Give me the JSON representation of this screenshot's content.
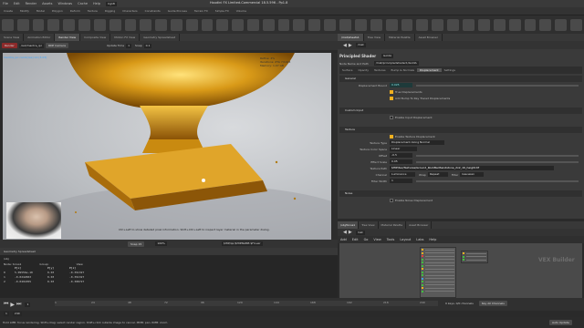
{
  "app": {
    "title": "Houdini FX Limited-Commercial 18.5.596 - Pp1.8",
    "menu": [
      "File",
      "Edit",
      "Render",
      "Assets",
      "Windows",
      "Cache",
      "Help"
    ],
    "desktop": "Cg18"
  },
  "shelf": {
    "tabs": [
      "Create",
      "Modify",
      "Model",
      "Polygon",
      "Deform",
      "Texture",
      "Rigging",
      "Characters",
      "Constraints",
      "Guide Process",
      "Terrain FX",
      "Simple FX",
      "Volume"
    ],
    "right_tabs": [
      "Lights and Cameras",
      "Collisions",
      "Particles",
      "Grains",
      "Vellum",
      "Rigid Bodies",
      "Particle Fluids",
      "Viscous Fluids",
      "Oceans",
      "Fluid Containers",
      "Populate Containers",
      "Container Tools",
      "Pyro FX",
      "Sparse Pyro FX",
      "FEM",
      "Wires",
      "Crowds",
      "Drive Simulation"
    ]
  },
  "viewport": {
    "tabs": [
      "Scene View",
      "Animation Editor",
      "Render View",
      "Composite View",
      "Motion FX View",
      "Geometry Spreadsheet"
    ],
    "active_tab": "Render View",
    "toolbar": {
      "render_button": "Render",
      "obj_path": "/out/mantra_ipr",
      "camera": "RDP Camera",
      "update_label": "Update Time",
      "update_value": "1",
      "snap_label": "Snap",
      "snap_value": "0.1"
    },
    "overlay_tl": "mantra_ipr:cam1[res] 14 [3.03]",
    "overlay_tr": [
      "Refine: 4%",
      "Iterations: ZTA 7/1024",
      "Memory: 1.07 GB"
    ],
    "hint": "Ctrl+Left to show detailed pixel information. Shift+Ctrl+Left to inspect layer material in the parameter dialog.",
    "snap_readout": "Snap 15",
    "zoom": "100%",
    "file_label": "$HIP/ipr/$HIPNAME.$F4.exr"
  },
  "geometry_spreadsheet": {
    "title": "Geometry Spreadsheet",
    "path": "/obj",
    "node": "Node: torus1",
    "group": "Group:",
    "view": "View",
    "columns": [
      "",
      "P[x]",
      "P[y]",
      "P[z]"
    ],
    "rows": [
      [
        "0",
        "5.09556e-10",
        "0.03",
        "-0.391327"
      ],
      [
        "1",
        "-0.0242063",
        "0.03",
        "-0.391327"
      ],
      [
        "2",
        "-0.0491855",
        "0.03",
        "-0.388727"
      ]
    ]
  },
  "playbar": {
    "current_frame": "1",
    "start": "1",
    "end": "240",
    "ticks": [
      "1",
      "24",
      "48",
      "72",
      "96",
      "120",
      "144",
      "168",
      "192",
      "216",
      "240"
    ],
    "range_end": "240",
    "keys_label": "0 keys, 0/0 channels",
    "key_all": "Key All Channels",
    "auto_update": "Auto Update"
  },
  "status": {
    "text": "Hold LMB: focus rendering. Shift+drag: select render region. Shift+click outside image to cancel. MMB: pan. RMB: zoom."
  },
  "params": {
    "tabs": [
      "/mat/sheets1",
      "Tree View",
      "Material Palette",
      "Asset Browser"
    ],
    "active_tab": "/mat/sheets1",
    "path": "/mat",
    "shader_type": "Principled Shader",
    "shader_name": "GoldA",
    "node_name_label": "Node Name and Path",
    "node_path": "/mat/principledshader1/GoldA",
    "subtabs": [
      "Surface",
      "Opacity",
      "Textures",
      "Bump & Normals",
      "Displacement",
      "Settings"
    ],
    "active_subtab": "Displacement",
    "sections": {
      "general": "General",
      "displacement_bound_label": "Displacement Bound",
      "displacement_bound_value": "0.025",
      "true_displacements": "True Displacements",
      "add_bump": "Add Bump To Ray Traced Displacements",
      "custom_input": "Custom Input",
      "enable_input": "Enable Input Displacement",
      "texture": "Texture",
      "enable_texture": "Enable Texture Displacement",
      "texture_type_label": "Texture Type",
      "texture_type_value": "Displacement Along Normal",
      "color_space_label": "Texture Color Space",
      "color_space_value": "Linear",
      "offset_label": "Offset",
      "offset_value": "-0.5",
      "effect_scale_label": "Effect Scale",
      "effect_scale_value": "0.05",
      "texture_path_label": "Texture Path",
      "texture_path_value": "$HIP/tex/Textures/Ground_RockBedSandstone_2x2_1K_height.tif",
      "channel_label": "Channel",
      "channel_value": "Luminance",
      "wrap_label": "Wrap",
      "wrap_value": "Repeat",
      "filter_label": "Filter",
      "filter_value": "Gaussian",
      "filter_width_label": "Filter Width",
      "filter_width_value": "1",
      "noise": "Noise",
      "enable_noise": "Enable Noise Displacement"
    }
  },
  "network": {
    "tabs": [
      "/obj/torus1",
      "Tree View",
      "Material Palette",
      "Asset Browser"
    ],
    "path": "mat",
    "menu": [
      "Add",
      "Edit",
      "Go",
      "View",
      "Tools",
      "Layout",
      "Labs",
      "Help"
    ],
    "watermark": "VEX Builder"
  },
  "colors": {
    "accent": "#f0b020",
    "selected_field": "#7fe0e0",
    "background": "#3a3a3a"
  }
}
